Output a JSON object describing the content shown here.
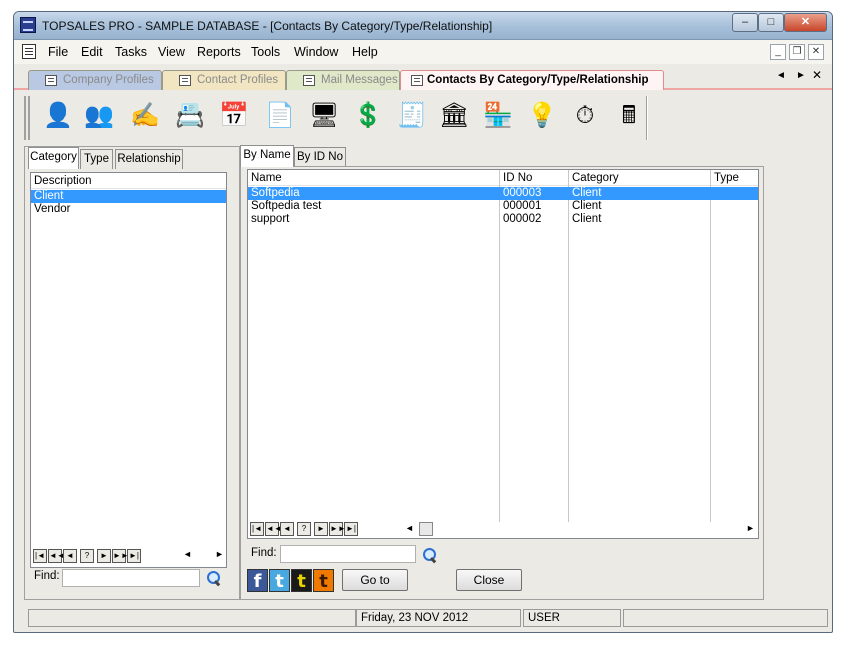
{
  "window": {
    "title": "TOPSALES PRO - SAMPLE DATABASE - [Contacts By Category/Type/Relationship]",
    "caption_minimize": "–",
    "caption_maximize": "□",
    "caption_close": "✕"
  },
  "menu": {
    "items": [
      "File",
      "Edit",
      "Tasks",
      "View",
      "Reports",
      "Tools",
      "Window",
      "Help"
    ],
    "mdi_minimize": "_",
    "mdi_restore": "❐",
    "mdi_close": "✕"
  },
  "doc_tabs": [
    {
      "label": "Company Profiles",
      "color": "#b9c9e4"
    },
    {
      "label": "Contact Profiles",
      "color": "#f2e6c2"
    },
    {
      "label": "Mail Messages",
      "color": "#dfe8c8"
    },
    {
      "label": "Contacts By Category/Type/Relationship",
      "color": "#fff4f4"
    }
  ],
  "tab_nav": {
    "prev": "◄",
    "next": "►",
    "close": "✕"
  },
  "toolbar": {
    "buttons": [
      {
        "icon": "contact-card-icon",
        "glyph": "👤"
      },
      {
        "icon": "people-icon",
        "glyph": "👥"
      },
      {
        "icon": "sign-document-icon",
        "glyph": "✍"
      },
      {
        "icon": "address-book-icon",
        "glyph": "📇"
      },
      {
        "icon": "calendar-icon",
        "glyph": "📅"
      },
      {
        "icon": "letter-icon",
        "glyph": "📄"
      },
      {
        "icon": "web-computer-icon",
        "glyph": "🖥"
      },
      {
        "icon": "dollar-document-icon",
        "glyph": "💲"
      },
      {
        "icon": "cash-register-icon",
        "glyph": "🧾"
      },
      {
        "icon": "bank-icon",
        "glyph": "🏛"
      },
      {
        "icon": "store-icon",
        "glyph": "🏪"
      },
      {
        "icon": "desk-lamp-icon",
        "glyph": "💡"
      },
      {
        "icon": "stopwatch-icon",
        "glyph": "⏱"
      },
      {
        "icon": "calculator-icon",
        "glyph": "🖩"
      }
    ]
  },
  "left_panel": {
    "tabs": [
      "Category",
      "Type",
      "Relationship"
    ],
    "column": "Description",
    "rows": [
      "Client",
      "Vendor"
    ],
    "selected_row": 0,
    "nav_buttons": [
      "|◄",
      "◄◄",
      "◄",
      "?",
      "►",
      "►►",
      "►|"
    ],
    "find_label": "Find:",
    "find_value": ""
  },
  "right_panel": {
    "tabs": [
      "By Name",
      "By ID No"
    ],
    "columns": [
      "Name",
      "ID No",
      "Category",
      "Type"
    ],
    "rows": [
      [
        "Softpedia",
        "000003",
        "Client",
        ""
      ],
      [
        "Softpedia test",
        "000001",
        "Client",
        ""
      ],
      [
        "support",
        "000002",
        "Client",
        ""
      ]
    ],
    "selected_row": 0,
    "nav_buttons": [
      "|◄",
      "◄◄",
      "◄",
      "?",
      "►",
      "►►",
      "►|"
    ],
    "find_label": "Find:",
    "find_value": "",
    "goto_label": "Go to",
    "close_label": "Close"
  },
  "social": [
    {
      "icon": "facebook-icon",
      "glyph": "f",
      "color": "#3b5998"
    },
    {
      "icon": "twitter-icon",
      "glyph": "t",
      "color": "#4aa8e0"
    },
    {
      "icon": "tumblr-icon",
      "glyph": "t",
      "color": "#d8c400"
    },
    {
      "icon": "blogger-icon",
      "glyph": "t",
      "color": "#f07a00"
    }
  ],
  "status": {
    "date": "Friday, 23 NOV 2012",
    "user": "USER"
  },
  "colors": {
    "selection": "#3399ff",
    "active_tab_border": "#e08a8a"
  }
}
